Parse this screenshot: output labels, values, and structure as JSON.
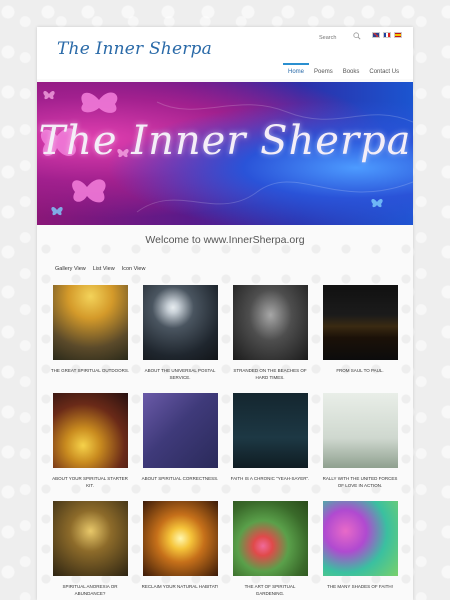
{
  "site": {
    "logo": "The Inner Sherpa",
    "search_placeholder": "Search"
  },
  "nav": {
    "items": [
      {
        "label": "Home"
      },
      {
        "label": "Poems"
      },
      {
        "label": "Books"
      },
      {
        "label": "Contact Us"
      }
    ]
  },
  "banner": {
    "title": "The Inner Sherpa"
  },
  "welcome": "Welcome to www.InnerSherpa.org",
  "views": {
    "gallery": "Gallery View",
    "list": "List View",
    "icon": "Icon View"
  },
  "posts": [
    {
      "caption": "THE GREAT SPIRITUAL OUTDOORS."
    },
    {
      "caption": "ABOUT THE UNIVERSAL POSTAL SERVICE."
    },
    {
      "caption": "STRANDED ON THE BEACHES OF HARD TIMES."
    },
    {
      "caption": "FROM SAUL TO PAUL."
    },
    {
      "caption": "ABOUT YOUR SPIRITUAL STARTER KIT."
    },
    {
      "caption": "ABOUT SPIRITUAL CORRECTNESS."
    },
    {
      "caption": "FAITH IS A CHRONIC \"YEAH-SAYER\"."
    },
    {
      "caption": "RALLY WITH THE UNITED FORCES OF LOVE IN ACTION."
    },
    {
      "caption": "SPIRITUAL ANOREXIA OR ABUNDANCE?"
    },
    {
      "caption": "RECLAIM YOUR NATURAL HABITAT!"
    },
    {
      "caption": "THE ART OF SPIRITUAL GARDENING."
    },
    {
      "caption": "THE MANY SHADES OF FAITH!"
    }
  ],
  "colors": {
    "accent": "#2a6aa8",
    "nav_active_bar": "#2a8fd0"
  }
}
